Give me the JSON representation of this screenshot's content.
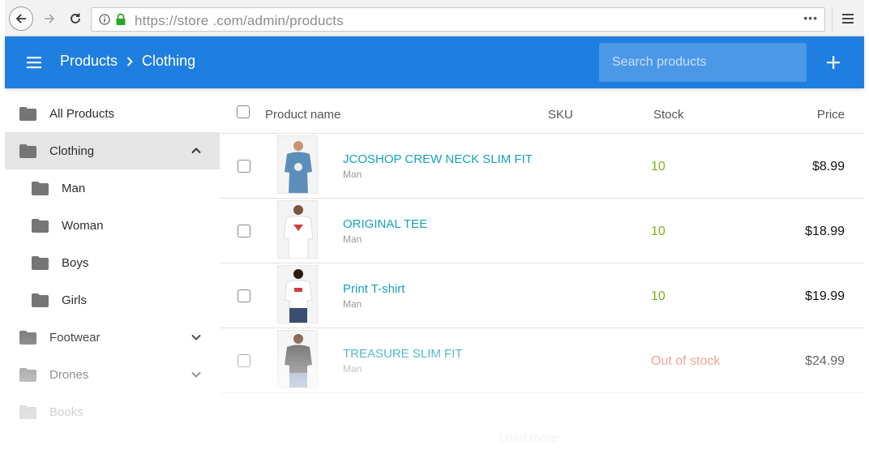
{
  "browser": {
    "url": "https://store .com/admin/products",
    "more_label": "•••"
  },
  "header": {
    "breadcrumb": [
      "Products",
      "Clothing"
    ],
    "search_placeholder": "Search products"
  },
  "sidebar": {
    "items": [
      {
        "label": "All Products"
      },
      {
        "label": "Clothing"
      },
      {
        "label": "Man"
      },
      {
        "label": "Woman"
      },
      {
        "label": "Boys"
      },
      {
        "label": "Girls"
      },
      {
        "label": "Footwear"
      },
      {
        "label": "Drones"
      },
      {
        "label": "Books"
      }
    ]
  },
  "table": {
    "columns": [
      "Product name",
      "SKU",
      "Stock",
      "Price"
    ],
    "rows": [
      {
        "name": "JCOSHOP CREW NECK SLIM FIT",
        "category": "Man",
        "stock": "10",
        "price": "$8.99"
      },
      {
        "name": "ORIGINAL TEE",
        "category": "Man",
        "stock": "10",
        "price": "$18.99"
      },
      {
        "name": "Print T-shirt",
        "category": "Man",
        "stock": "10",
        "price": "$19.99"
      },
      {
        "name": "TREASURE SLIM FIT",
        "category": "Man",
        "stock": "Out of stock",
        "price": "$24.99"
      }
    ]
  },
  "load_more": "Load more",
  "colors": {
    "header_bg": "#1e7fe0",
    "link": "#159fbd",
    "in_stock": "#7cb518",
    "out_of_stock": "#e8735a"
  }
}
